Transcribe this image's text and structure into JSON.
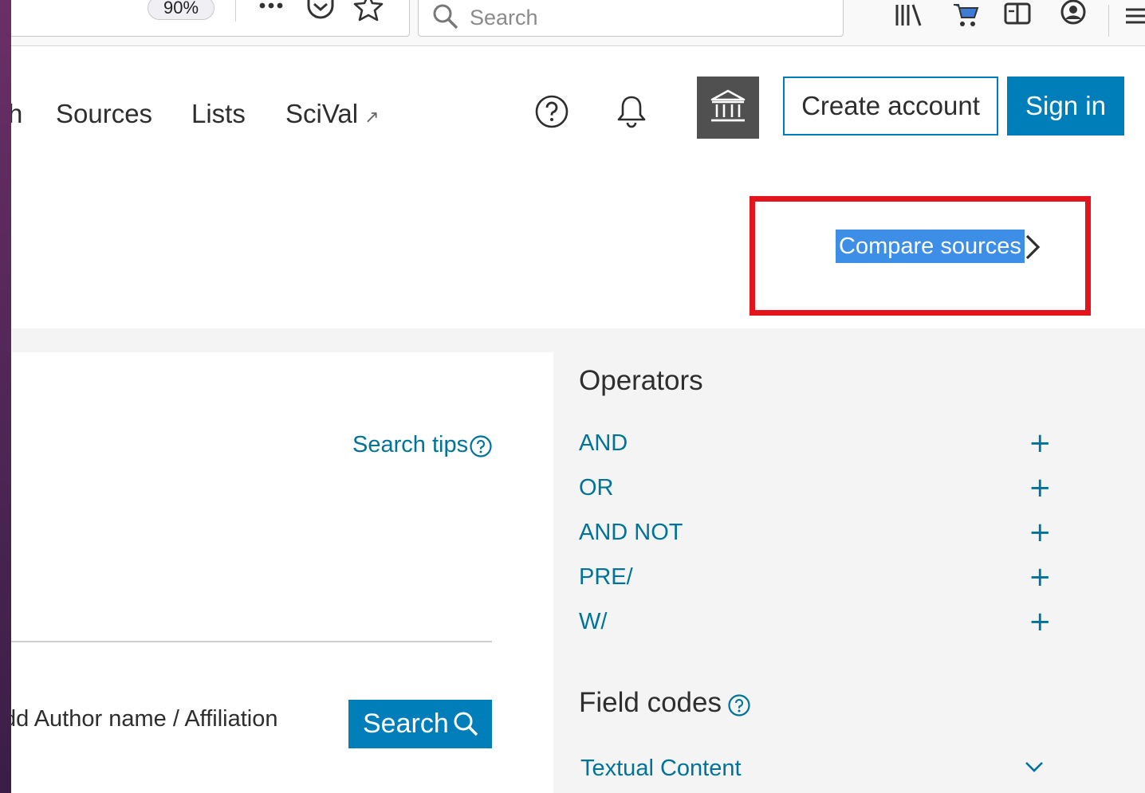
{
  "browser": {
    "zoom_level": "90%",
    "search_placeholder": "Search"
  },
  "header": {
    "nav": {
      "partial": "h",
      "sources": "Sources",
      "lists": "Lists",
      "scival": "SciVal",
      "external_arrow": "↗"
    },
    "create_account_label": "Create account",
    "sign_in_label": "Sign in"
  },
  "compare": {
    "label": "Compare sources"
  },
  "search_panel": {
    "search_tips_label": "Search tips",
    "add_author_label": "dd Author name / Affiliation",
    "search_button_label": "Search"
  },
  "operators": {
    "title": "Operators",
    "items": [
      {
        "label": "AND",
        "action": "+"
      },
      {
        "label": "OR",
        "action": "+"
      },
      {
        "label": "AND NOT",
        "action": "+"
      },
      {
        "label": "PRE/",
        "action": "+"
      },
      {
        "label": "W/",
        "action": "+"
      }
    ]
  },
  "field_codes": {
    "title": "Field codes",
    "textual_content_label": "Textual Content"
  },
  "colors": {
    "primary": "#007eb9",
    "link": "#007398",
    "highlight_border": "#e3141b",
    "selection": "#3d8ee6",
    "institution_button": "#505050"
  }
}
